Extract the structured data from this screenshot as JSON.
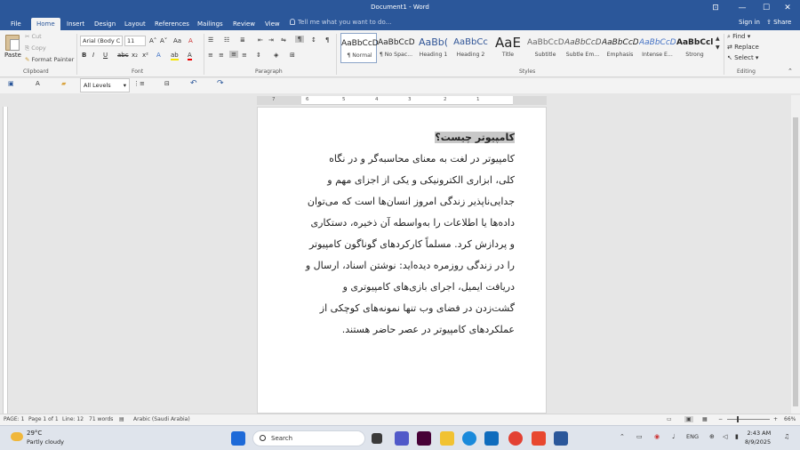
{
  "titlebar": {
    "title": "Document1 - Word",
    "buttons": [
      "⊡",
      "—",
      "☐",
      "✕"
    ]
  },
  "tabs": [
    "File",
    "Home",
    "Insert",
    "Design",
    "Layout",
    "References",
    "Mailings",
    "Review",
    "View"
  ],
  "active_tab": "Home",
  "tellme": "Tell me what you want to do...",
  "signin": "Sign in",
  "share": "Share",
  "clipboard": {
    "paste": "Paste",
    "cut": "Cut",
    "copy": "Copy",
    "format_painter": "Format Painter",
    "label": "Clipboard"
  },
  "font": {
    "name": "Arial (Body C",
    "size": "11",
    "label": "Font",
    "grow": "A˄",
    "shrink": "A˅",
    "case": "Aa",
    "clear": "A",
    "bold": "B",
    "italic": "I",
    "underline": "U",
    "strike": "abc",
    "sub": "x₂",
    "sup": "x²",
    "effects": "A",
    "highlight": "ab",
    "color": "A"
  },
  "paragraph": {
    "label": "Paragraph",
    "pilcrow": "¶"
  },
  "styles": {
    "label": "Styles",
    "items": [
      {
        "preview": "AaBbCcD",
        "name": "¶ Normal"
      },
      {
        "preview": "AaBbCcD",
        "name": "¶ No Spac..."
      },
      {
        "preview": "AaBb(",
        "name": "Heading 1"
      },
      {
        "preview": "AaBbCc",
        "name": "Heading 2"
      },
      {
        "preview": "AaE",
        "name": "Title"
      },
      {
        "preview": "AaBbCcD",
        "name": "Subtitle"
      },
      {
        "preview": "AaBbCcD",
        "name": "Subtle Em..."
      },
      {
        "preview": "AaBbCcD",
        "name": "Emphasis"
      },
      {
        "preview": "AaBbCcD",
        "name": "Intense E..."
      },
      {
        "preview": "AaBbCcl",
        "name": "Strong"
      }
    ]
  },
  "editing": {
    "find": "Find",
    "replace": "Replace",
    "select": "Select",
    "label": "Editing"
  },
  "qat": {
    "all_levels": "All Levels"
  },
  "ruler": {
    "numbers": [
      "7",
      "6",
      "5",
      "4",
      "3",
      "2",
      "1"
    ]
  },
  "document": {
    "heading": "کامپیوتر چیست؟",
    "lines": [
      "کامپیوتر در لغت به معنای محاسبه‌گر و در نگاه",
      "کلی، ابزاری الکترونیکی و یکی از اجزای مهم و",
      "جدایی‌ناپذیر زندگی امروز انسان‌ها است که می‌توان",
      "داده‌ها یا اطلاعات را به‌واسطه آن ذخیره، دستکاری",
      "و پردازش کرد. مسلماً کارکردهای گوناگون کامپیوتر",
      "را در زندگی روزمره دیده‌اید: نوشتن اسناد، ارسال و",
      "دریافت ایمیل، اجرای بازی‌های کامپیوتری و",
      "گشت‌زدن در فضای وب تنها نمونه‌های کوچکی از",
      "عملکردهای کامپیوتر در عصر حاضر هستند."
    ]
  },
  "status": {
    "page": "PAGE: 1",
    "page_of": "Page 1 of 1",
    "line": "Line: 12",
    "words": "71 words",
    "language": "Arabic (Saudi Arabia)",
    "zoom": "66%"
  },
  "taskbar": {
    "temp": "29°C",
    "weather": "Partly cloudy",
    "search": "Search",
    "time": "2:43 AM",
    "date": "8/9/2025",
    "lang": "ENG"
  }
}
